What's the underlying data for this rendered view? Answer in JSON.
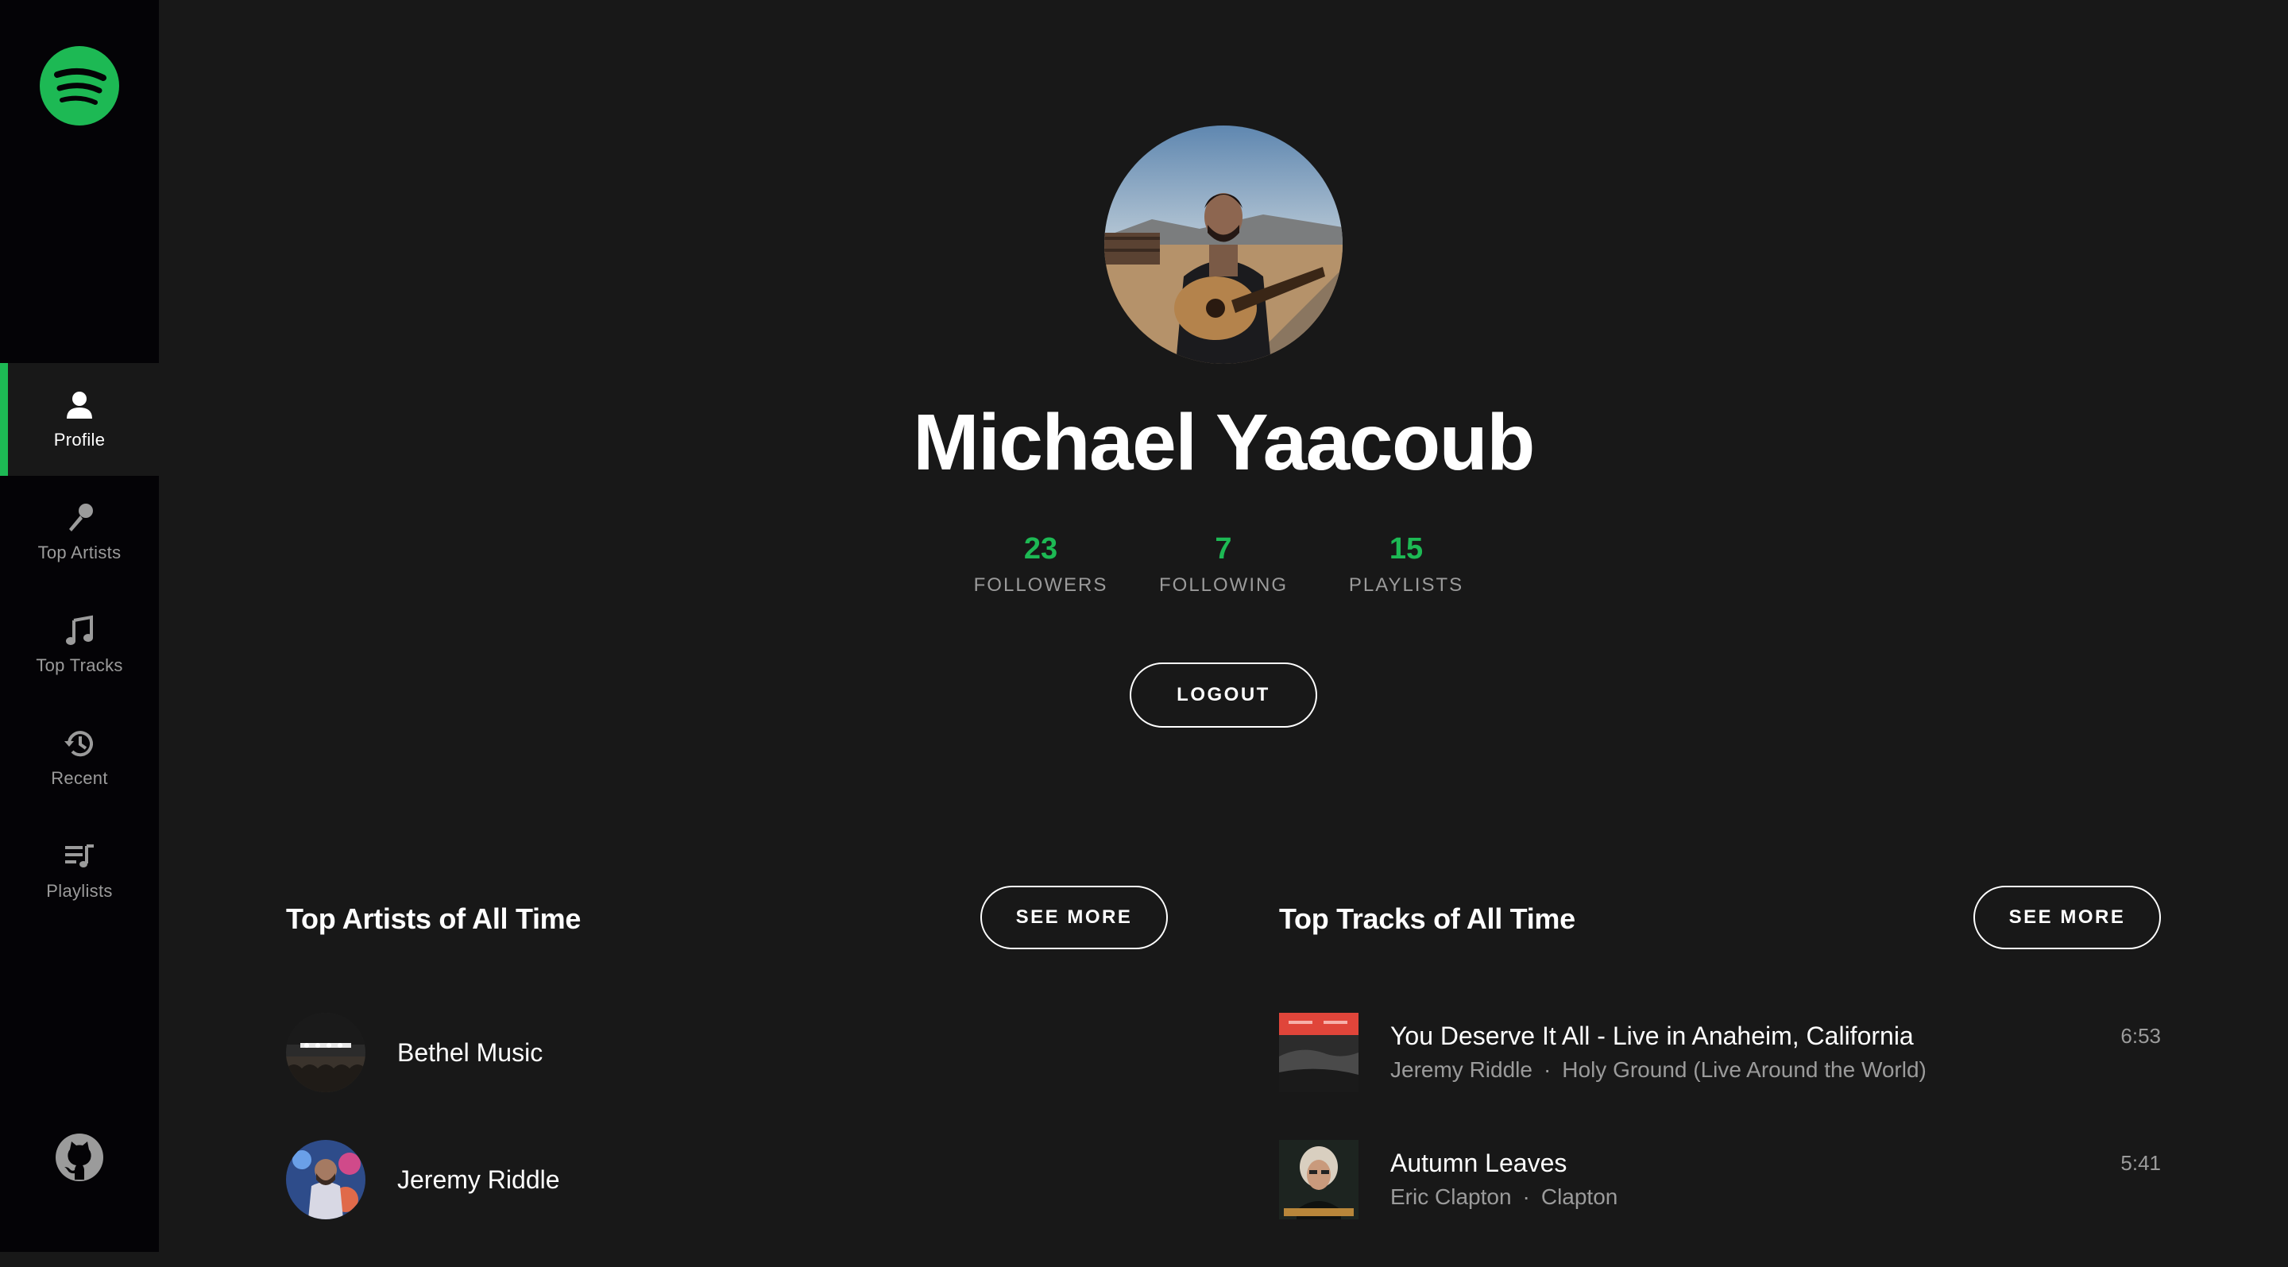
{
  "app": {
    "brand_color": "#1db954",
    "logo_icon": "spotify-logo-icon"
  },
  "sidebar": {
    "items": [
      {
        "label": "Profile",
        "icon": "user-icon",
        "active": true
      },
      {
        "label": "Top Artists",
        "icon": "microphone-icon",
        "active": false
      },
      {
        "label": "Top Tracks",
        "icon": "music-note-icon",
        "active": false
      },
      {
        "label": "Recent",
        "icon": "history-icon",
        "active": false
      },
      {
        "label": "Playlists",
        "icon": "playlist-icon",
        "active": false
      }
    ],
    "footer_icon": "github-icon"
  },
  "profile": {
    "name": "Michael Yaacoub",
    "stats": [
      {
        "value": "23",
        "label": "FOLLOWERS"
      },
      {
        "value": "7",
        "label": "FOLLOWING"
      },
      {
        "value": "15",
        "label": "PLAYLISTS"
      }
    ],
    "logout_label": "LOGOUT"
  },
  "top_artists": {
    "title": "Top Artists of All Time",
    "see_more_label": "SEE MORE",
    "items": [
      {
        "name": "Bethel Music"
      },
      {
        "name": "Jeremy Riddle"
      }
    ]
  },
  "top_tracks": {
    "title": "Top Tracks of All Time",
    "see_more_label": "SEE MORE",
    "separator": "·",
    "items": [
      {
        "name": "You Deserve It All - Live in Anaheim, California",
        "artist": "Jeremy Riddle",
        "album": "Holy Ground (Live Around the World)",
        "duration": "6:53"
      },
      {
        "name": "Autumn Leaves",
        "artist": "Eric Clapton",
        "album": "Clapton",
        "duration": "5:41"
      }
    ]
  }
}
